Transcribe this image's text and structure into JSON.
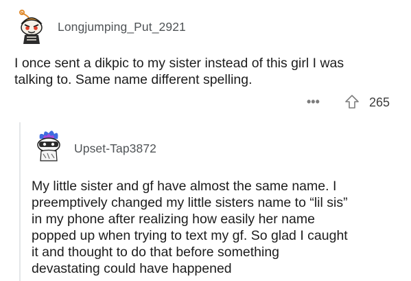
{
  "comment": {
    "author": "Longjumping_Put_2921",
    "avatar_icon": "snoo-avatar-orange-hat-icon",
    "lines": [
      "I once sent a dikpic to my sister instead of this girl I was",
      "talking to. Same name different spelling."
    ],
    "more_icon": "ellipsis-icon",
    "upvote_icon": "upvote-arrow-icon",
    "score": "265"
  },
  "reply": {
    "author": "Upset-Tap3872",
    "avatar_icon": "snoo-avatar-blue-flame-icon",
    "lines": [
      "My little sister and gf have almost the same name. I",
      "preemptively changed my little sisters name to “lil sis”",
      "in my phone after realizing how easily her name",
      "popped up when trying to text my gf. So glad I caught",
      "it and thought to do that before something",
      "devastating could have happened"
    ]
  },
  "colors": {
    "author_text": "#4f5356",
    "body_text": "#1c1c1c",
    "thread_line": "#e4e6e8",
    "icon_gray": "#7c7c7c"
  }
}
